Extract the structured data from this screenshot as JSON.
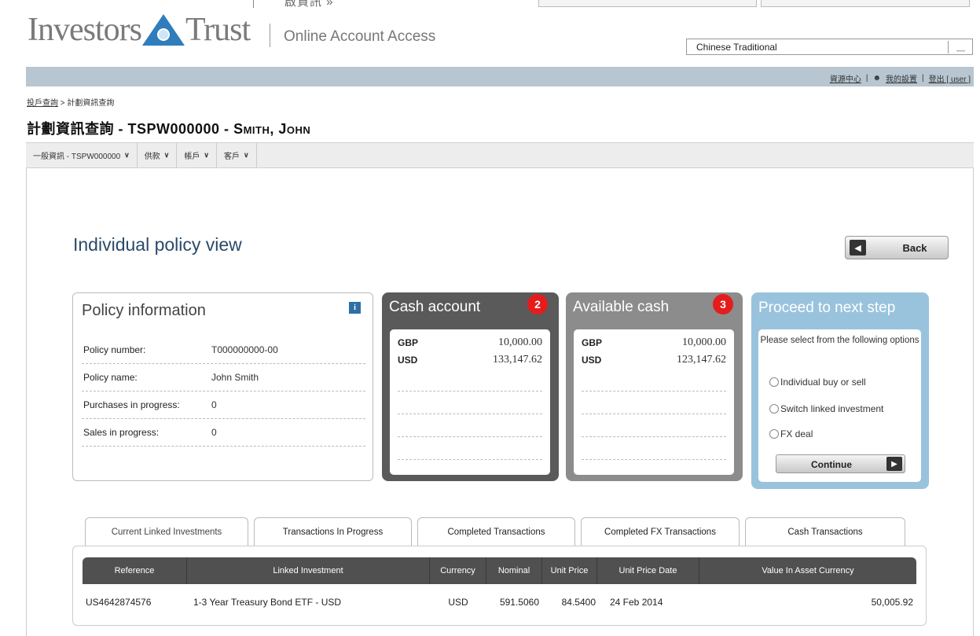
{
  "top_prev_text": "啟資訊 »",
  "header": {
    "logo_left": "Investors",
    "logo_right": "Trust",
    "subtitle": "Online Account Access",
    "language": "Chinese Traditional"
  },
  "top_links": {
    "resource_center": "資源中心",
    "person_icon": "person-icon",
    "my_profile": "我的設置",
    "logout": "登出 [ user ]"
  },
  "breadcrumb": {
    "root": "投戶查詢",
    "sep": ">",
    "current": "計劃資訊查詢"
  },
  "page_title": {
    "prefix": "計劃資訊查詢 - TSPW000000 - ",
    "name": "Smith, John"
  },
  "nav_tabs": [
    {
      "label": "一般資訊 - TSPW000000"
    },
    {
      "label": "供款"
    },
    {
      "label": "帳戶"
    },
    {
      "label": "客戶"
    }
  ],
  "main": {
    "title": "Individual policy view",
    "back_label": "Back"
  },
  "policy": {
    "title": "Policy information",
    "info_icon": "i",
    "rows": [
      {
        "key": "Policy number:",
        "value": "T000000000-00"
      },
      {
        "key": "Policy name:",
        "value": "John Smith"
      },
      {
        "key": "Purchases in progress:",
        "value": "0"
      },
      {
        "key": "Sales in progress:",
        "value": "0"
      }
    ]
  },
  "cash_account": {
    "title": "Cash account",
    "badge": "2",
    "rows": [
      {
        "currency": "GBP",
        "amount": "10,000.00"
      },
      {
        "currency": "USD",
        "amount": "133,147.62"
      }
    ]
  },
  "available_cash": {
    "title": "Available cash",
    "badge": "3",
    "rows": [
      {
        "currency": "GBP",
        "amount": "10,000.00"
      },
      {
        "currency": "USD",
        "amount": "123,147.62"
      }
    ]
  },
  "proceed": {
    "title": "Proceed to next step",
    "instruction": "Please select from the following options",
    "options": [
      "Individual buy or sell",
      "Switch linked investment",
      "FX deal"
    ],
    "continue_label": "Continue"
  },
  "tabs": [
    "Current Linked Investments",
    "Transactions In Progress",
    "Completed Transactions",
    "Completed FX Transactions",
    "Cash Transactions"
  ],
  "table": {
    "headers": [
      "Reference",
      "Linked Investment",
      "Currency",
      "Nominal",
      "Unit Price",
      "Unit Price Date",
      "Value In Asset Currency"
    ],
    "rows": [
      [
        "US4642874576",
        "1-3 Year Treasury Bond ETF - USD",
        "USD",
        "591.5060",
        "84.5400",
        "24 Feb 2014",
        "50,005.92"
      ]
    ]
  },
  "colors": {
    "accent_blue": "#2f7dbd",
    "cash_account_bg": "#5a5a5a",
    "available_cash_bg": "#8c8c8c",
    "proceed_bg": "#99c3dd",
    "badge_red": "#e51c1c"
  }
}
